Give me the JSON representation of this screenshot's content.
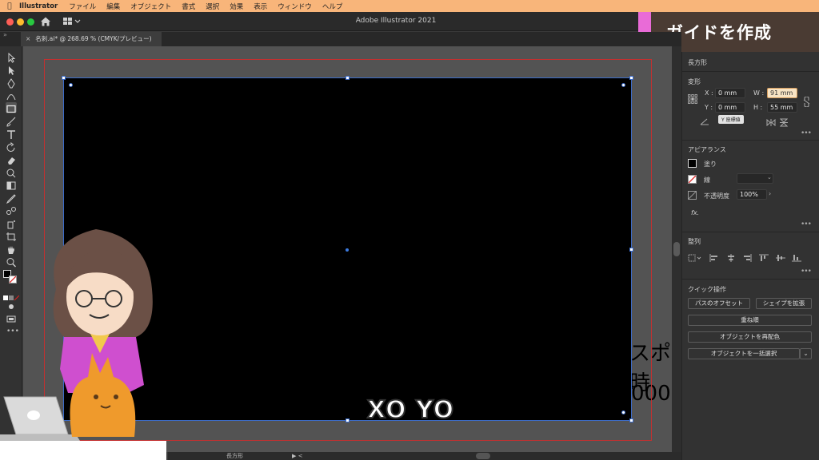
{
  "menubar": {
    "app_name": "Illustrator",
    "items": [
      "ファイル",
      "編集",
      "オブジェクト",
      "書式",
      "選択",
      "効果",
      "表示",
      "ウィンドウ",
      "ヘルプ"
    ]
  },
  "window": {
    "title": "Adobe Illustrator 2021"
  },
  "badge": {
    "text": "ガイドを作成",
    "accent": "#e96bd7",
    "bg": "#4a3b33"
  },
  "tab": {
    "label": "名刺.ai* @ 268.69 % (CMYK/プレビュー)"
  },
  "canvas": {
    "background_text": [
      "スポ時",
      "000"
    ],
    "overlay_caption": "XO YO",
    "artboard_color": "#000000",
    "bleed_color": "#c23030",
    "selection_color": "#3c6cc9"
  },
  "statusbar": {
    "label": "長方形"
  },
  "panel": {
    "object_type": "長方形",
    "transform": {
      "title": "変形",
      "x_label": "X :",
      "x_value": "0 mm",
      "y_label": "Y :",
      "y_value": "0 mm",
      "w_label": "W :",
      "w_value": "91 mm",
      "h_label": "H :",
      "h_value": "55 mm",
      "tooltip": "Y 座標値"
    },
    "appearance": {
      "title": "アピアランス",
      "fill_label": "塗り",
      "stroke_label": "線",
      "opacity_label": "不透明度",
      "opacity_value": "100%",
      "fx_label": "fx."
    },
    "align": {
      "title": "整列"
    },
    "quick_actions": {
      "title": "クイック操作",
      "offset_path": "パスのオフセット",
      "expand_shape": "シェイプを拡張",
      "arrange": "重ね順",
      "recolor": "オブジェクトを再配色",
      "select_same": "オブジェクトを一括選択"
    }
  }
}
